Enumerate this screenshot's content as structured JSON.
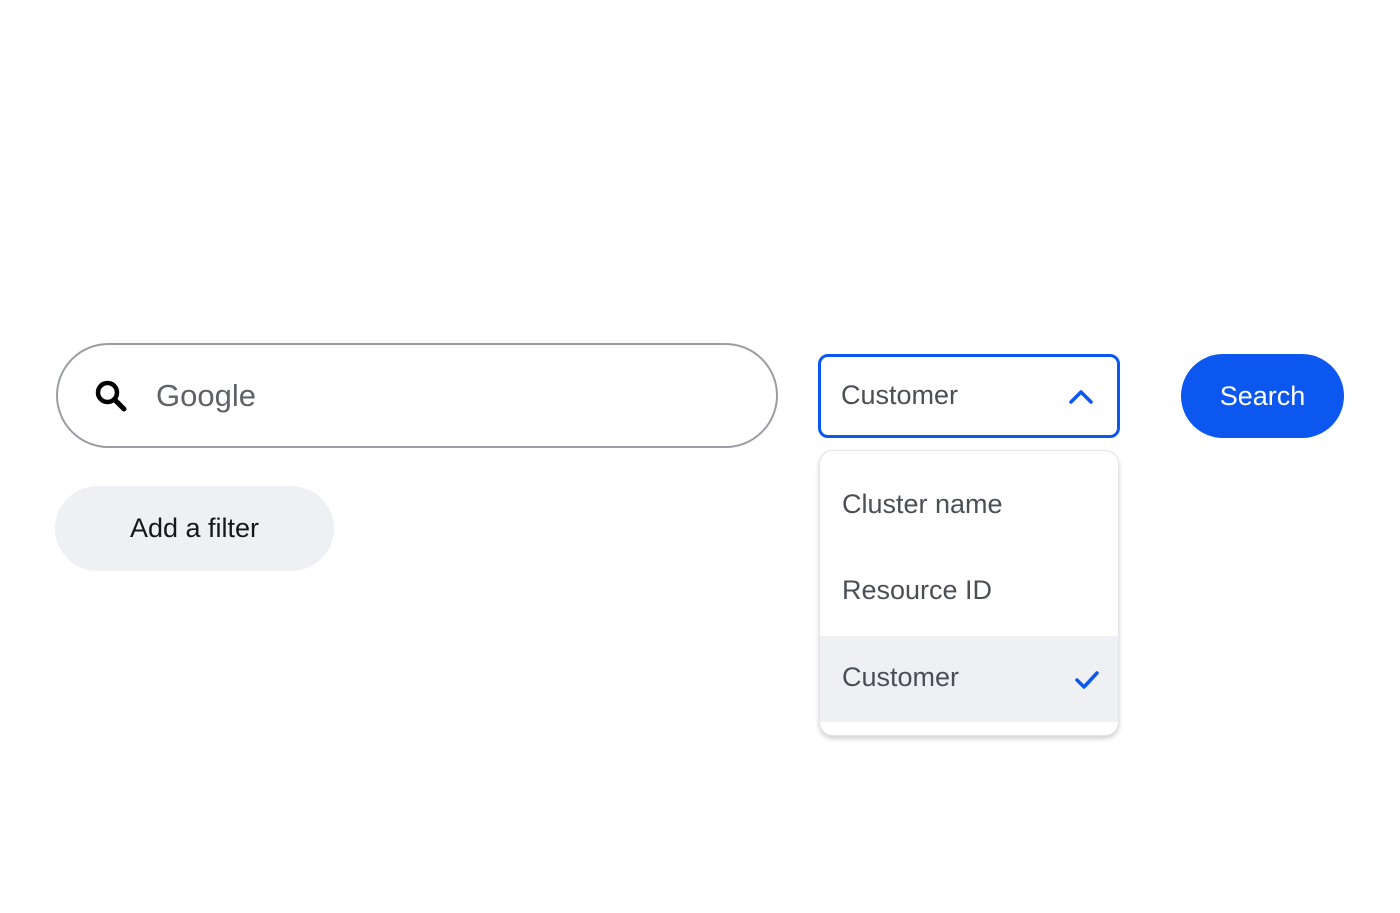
{
  "search": {
    "value": "Google",
    "icon": "search-icon"
  },
  "filter_button": {
    "label": "Add a filter"
  },
  "field_select": {
    "selected_label": "Customer",
    "icon": "chevron-up-icon",
    "expanded": true,
    "options": [
      {
        "label": "Cluster name",
        "selected": false
      },
      {
        "label": "Resource ID",
        "selected": false
      },
      {
        "label": "Customer",
        "selected": true,
        "icon": "check-icon"
      }
    ]
  },
  "search_button": {
    "label": "Search"
  },
  "colors": {
    "accent": "#0b57f0",
    "chip_background": "#eff0f3",
    "text_primary": "#15171a",
    "text_secondary": "#4a4f55",
    "border": "#9a9ea4"
  }
}
